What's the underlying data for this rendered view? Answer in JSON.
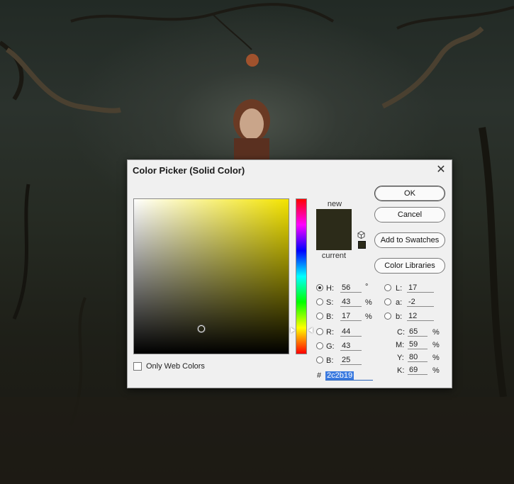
{
  "dialog": {
    "title": "Color Picker (Solid Color)",
    "close_glyph": "✕",
    "new_label": "new",
    "current_label": "current",
    "new_color": "#2c2b19",
    "current_color": "#2c2b19",
    "buttons": {
      "ok": "OK",
      "cancel": "Cancel",
      "add_to_swatches": "Add to Swatches",
      "color_libraries": "Color Libraries"
    },
    "only_web_colors_label": "Only Web Colors",
    "only_web_colors_checked": false,
    "hsb": {
      "h": {
        "label": "H:",
        "value": "56",
        "unit": "°"
      },
      "s": {
        "label": "S:",
        "value": "43",
        "unit": "%"
      },
      "b": {
        "label": "B:",
        "value": "17",
        "unit": "%"
      }
    },
    "rgb": {
      "r": {
        "label": "R:",
        "value": "44"
      },
      "g": {
        "label": "G:",
        "value": "43"
      },
      "b": {
        "label": "B:",
        "value": "25"
      }
    },
    "lab": {
      "l": {
        "label": "L:",
        "value": "17"
      },
      "a": {
        "label": "a:",
        "value": "-2"
      },
      "b": {
        "label": "b:",
        "value": "12"
      }
    },
    "cmyk": {
      "c": {
        "label": "C:",
        "value": "65",
        "unit": "%"
      },
      "m": {
        "label": "M:",
        "value": "59",
        "unit": "%"
      },
      "y": {
        "label": "Y:",
        "value": "80",
        "unit": "%"
      },
      "k": {
        "label": "K:",
        "value": "69",
        "unit": "%"
      }
    },
    "hex": {
      "label": "#",
      "value": "2c2b19"
    },
    "selected_mode": "H",
    "field_cursor": {
      "saturation": 0.43,
      "brightness": 0.17
    },
    "hue_slider_value": 56
  }
}
